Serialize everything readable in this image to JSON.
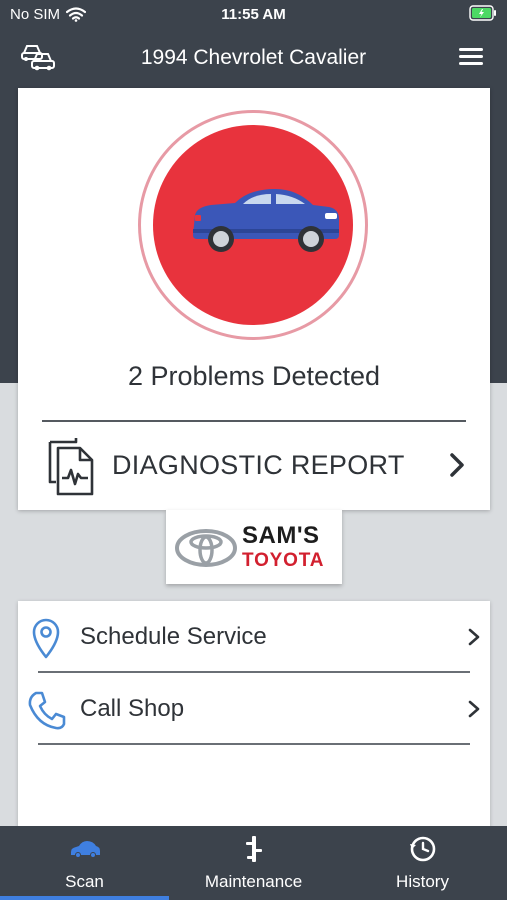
{
  "status_bar": {
    "carrier": "No SIM",
    "time": "11:55 AM"
  },
  "header": {
    "title": "1994 Chevrolet Cavalier",
    "left_icon": "vehicles-icon",
    "right_icon": "menu-icon"
  },
  "scan": {
    "status_color": "#e8333d",
    "problems_text": "2 Problems Detected",
    "report_label": "DIAGNOSTIC REPORT"
  },
  "dealer": {
    "name": "SAM'S",
    "brand": "TOYOTA"
  },
  "actions": [
    {
      "label": "Schedule Service",
      "icon": "location-pin-icon"
    },
    {
      "label": "Call Shop",
      "icon": "phone-icon"
    }
  ],
  "tabs": [
    {
      "label": "Scan",
      "icon": "car-icon",
      "active": true
    },
    {
      "label": "Maintenance",
      "icon": "wrench-icon",
      "active": false
    },
    {
      "label": "History",
      "icon": "history-icon",
      "active": false
    }
  ],
  "colors": {
    "header_bg": "#3c434c",
    "accent": "#3f7fe0",
    "alert": "#e8333d"
  }
}
